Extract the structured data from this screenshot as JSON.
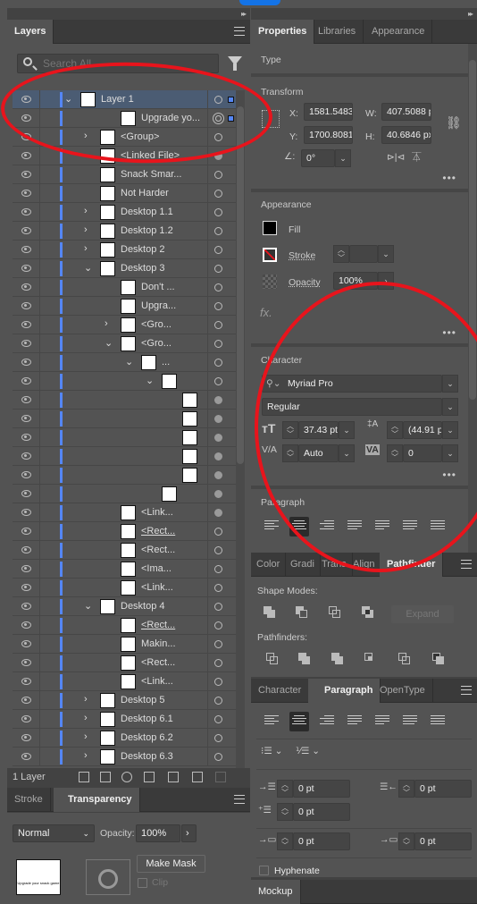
{
  "layers_panel": {
    "tabs": [
      {
        "label": "Layers",
        "active": true
      }
    ],
    "search_placeholder": "Search All",
    "layer_count": "1 Layer",
    "rows": [
      {
        "name": "Layer 1",
        "depth": 0,
        "chevron": "down",
        "selected": true,
        "target": "ring",
        "sel_square": true
      },
      {
        "name": "Upgrade yo...",
        "depth": 2,
        "chevron": "",
        "target": "double",
        "sel_square": true
      },
      {
        "name": "<Group>",
        "depth": 1,
        "chevron": "right",
        "target": "ring"
      },
      {
        "name": "<Linked File>",
        "depth": 1,
        "chevron": "",
        "target": "filled"
      },
      {
        "name": "Snack Smar...",
        "depth": 1,
        "chevron": "",
        "target": "ring"
      },
      {
        "name": "Not Harder",
        "depth": 1,
        "chevron": "",
        "target": "ring"
      },
      {
        "name": "Desktop 1.1",
        "depth": 1,
        "chevron": "right",
        "target": "ring"
      },
      {
        "name": "Desktop 1.2",
        "depth": 1,
        "chevron": "right",
        "target": "ring"
      },
      {
        "name": "Desktop 2",
        "depth": 1,
        "chevron": "right",
        "target": "ring"
      },
      {
        "name": "Desktop 3",
        "depth": 1,
        "chevron": "down",
        "target": "ring"
      },
      {
        "name": "Don't ...",
        "depth": 2,
        "chevron": "",
        "target": "ring"
      },
      {
        "name": "Upgra...",
        "depth": 2,
        "chevron": "",
        "target": "ring"
      },
      {
        "name": "<Gro...",
        "depth": 2,
        "chevron": "right",
        "target": "ring"
      },
      {
        "name": "<Gro...",
        "depth": 2,
        "chevron": "down",
        "target": "ring"
      },
      {
        "name": "...",
        "depth": 3,
        "chevron": "down",
        "target": "ring"
      },
      {
        "name": "",
        "depth": 4,
        "chevron": "down",
        "target": "ring"
      },
      {
        "name": "",
        "depth": 5,
        "chevron": "",
        "target": "filled"
      },
      {
        "name": "",
        "depth": 5,
        "chevron": "",
        "target": "filled"
      },
      {
        "name": "",
        "depth": 5,
        "chevron": "",
        "target": "filled"
      },
      {
        "name": "",
        "depth": 5,
        "chevron": "",
        "target": "filled"
      },
      {
        "name": "",
        "depth": 5,
        "chevron": "",
        "target": "filled"
      },
      {
        "name": "",
        "depth": 4,
        "chevron": "",
        "target": "filled"
      },
      {
        "name": "<Link...",
        "depth": 2,
        "chevron": "",
        "target": "filled"
      },
      {
        "name": "<Rect...",
        "depth": 2,
        "chevron": "",
        "target": "ring",
        "underline": true
      },
      {
        "name": "<Rect...",
        "depth": 2,
        "chevron": "",
        "target": "ring"
      },
      {
        "name": "<Ima...",
        "depth": 2,
        "chevron": "",
        "target": "ring"
      },
      {
        "name": "<Link...",
        "depth": 2,
        "chevron": "",
        "target": "ring"
      },
      {
        "name": "Desktop 4",
        "depth": 1,
        "chevron": "down",
        "target": "ring"
      },
      {
        "name": "<Rect...",
        "depth": 2,
        "chevron": "",
        "target": "ring",
        "underline": true
      },
      {
        "name": "Makin...",
        "depth": 2,
        "chevron": "",
        "target": "ring"
      },
      {
        "name": "<Rect...",
        "depth": 2,
        "chevron": "",
        "target": "ring"
      },
      {
        "name": "<Link...",
        "depth": 2,
        "chevron": "",
        "target": "ring"
      },
      {
        "name": "Desktop 5",
        "depth": 1,
        "chevron": "right",
        "target": "ring"
      },
      {
        "name": "Desktop 6.1",
        "depth": 1,
        "chevron": "right",
        "target": "ring"
      },
      {
        "name": "Desktop 6.2",
        "depth": 1,
        "chevron": "right",
        "target": "ring"
      },
      {
        "name": "Desktop 6.3",
        "depth": 1,
        "chevron": "right",
        "target": "ring"
      }
    ]
  },
  "transparency_panel": {
    "tabs": [
      {
        "label": "Stroke",
        "active": false
      },
      {
        "label": "Transparency",
        "active": true
      }
    ],
    "blend_mode": "Normal",
    "opacity_label": "Opacity:",
    "opacity_value": "100%",
    "make_mask_label": "Make Mask",
    "clip_label": "Clip",
    "thumbnail_text": "Upgrade your snack game"
  },
  "properties_panel": {
    "tabs": [
      {
        "label": "Properties",
        "active": true
      },
      {
        "label": "Libraries",
        "active": false
      },
      {
        "label": "Appearance",
        "active": false
      }
    ],
    "type_label": "Type",
    "transform": {
      "title": "Transform",
      "x_label": "X:",
      "x": "1581.5483",
      "y_label": "Y:",
      "y": "1700.8081",
      "w_label": "W:",
      "w": "407.5088 p",
      "h_label": "H:",
      "h": "40.6846 px",
      "angle": "0°"
    },
    "appearance": {
      "title": "Appearance",
      "fill_label": "Fill",
      "stroke_label": "Stroke",
      "opacity_label": "Opacity",
      "opacity_value": "100%",
      "fx_label": "fx."
    },
    "character": {
      "title": "Character",
      "font_family": "Myriad Pro",
      "font_style": "Regular",
      "font_size": "37.43 pt",
      "leading": "(44.91 pt",
      "kerning": "Auto",
      "tracking": "0"
    },
    "paragraph": {
      "title": "Paragraph",
      "active_alignment": 1
    }
  },
  "pathfinder_panel": {
    "tabs": [
      {
        "label": "Color"
      },
      {
        "label": "Gradi"
      },
      {
        "label": "Trans"
      },
      {
        "label": "Align"
      },
      {
        "label": "Pathfinder",
        "active": true
      }
    ],
    "shape_modes_label": "Shape Modes:",
    "pathfinders_label": "Pathfinders:",
    "expand_label": "Expand"
  },
  "paragraph_panel": {
    "tabs": [
      {
        "label": "Character"
      },
      {
        "label": "Paragraph",
        "active": true
      },
      {
        "label": "OpenType"
      }
    ],
    "left_indent": "0 pt",
    "right_indent": "0 pt",
    "first_line_indent": "0 pt",
    "space_before": "0 pt",
    "space_after": "0 pt",
    "hyphenate_label": "Hyphenate",
    "hyphenate_checked": false,
    "active_alignment": 1
  },
  "bottom_tab": {
    "label": "Mockup"
  },
  "colors": {
    "accent": "#5486f5",
    "selected_row": "#4b5c73",
    "annotation": "#e8141c"
  }
}
